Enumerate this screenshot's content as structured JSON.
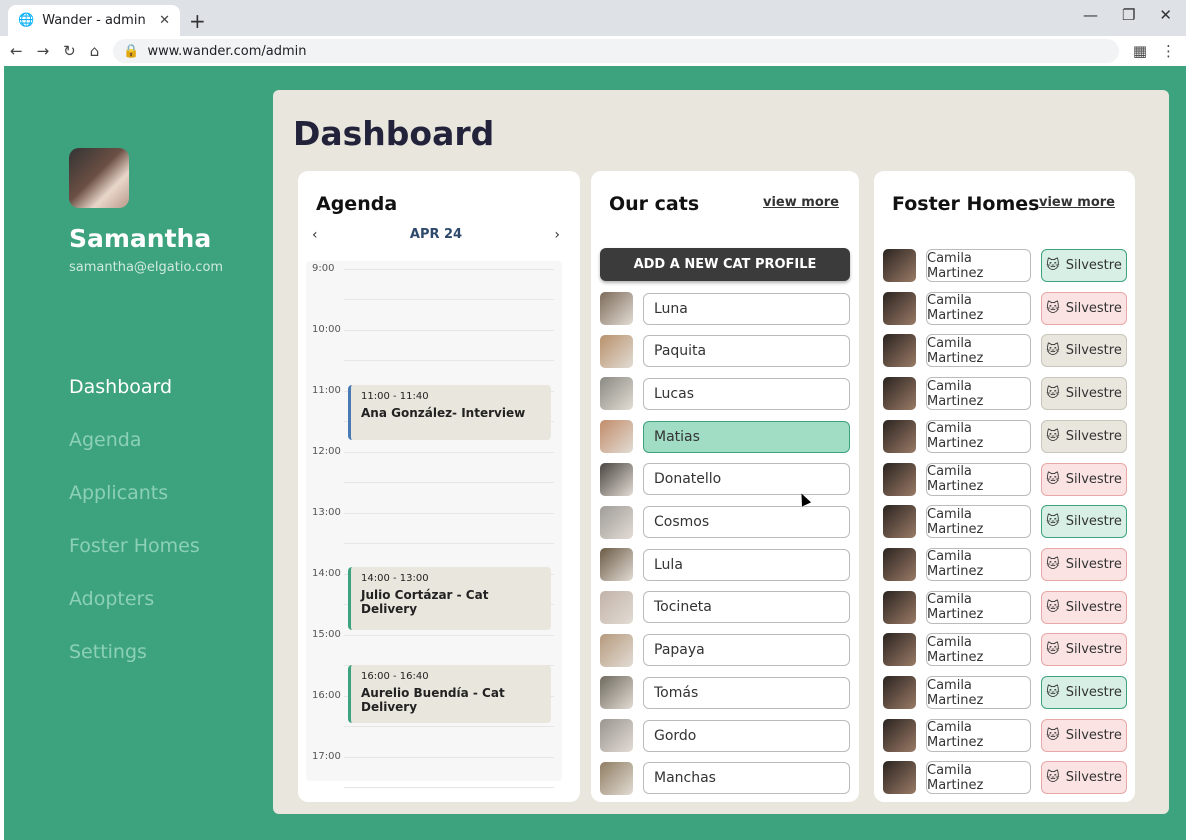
{
  "browser": {
    "tab_title": "Wander - admin",
    "url": "www.wander.com/admin"
  },
  "user": {
    "name": "Samantha",
    "email": "samantha@elgatio.com"
  },
  "nav": [
    "Dashboard",
    "Agenda",
    "Applicants",
    "Foster Homes",
    "Adopters",
    "Settings"
  ],
  "page_title": "Dashboard",
  "agenda": {
    "title": "Agenda",
    "date": "APR 24",
    "prev": "‹",
    "next": "›",
    "hours": [
      "9:00",
      "10:00",
      "11:00",
      "12:00",
      "13:00",
      "14:00",
      "15:00",
      "16:00",
      "17:00"
    ],
    "events": [
      {
        "time": "11:00 - 11:40",
        "name": "Ana González- Interview",
        "accent": "#4a7ab5"
      },
      {
        "time": "14:00 - 13:00",
        "name": "Julio Cortázar - Cat Delivery",
        "accent": "#3da37f"
      },
      {
        "time": "16:00 - 16:40",
        "name": "Aurelio Buendía - Cat Delivery",
        "accent": "#3da37f"
      }
    ]
  },
  "cats": {
    "title": "Our cats",
    "view_more": "view more",
    "add_button": "ADD A NEW CAT PROFILE",
    "selected": "Matias",
    "items": [
      "Luna",
      "Paquita",
      "Lucas",
      "Matias",
      "Donatello",
      "Cosmos",
      "Lula",
      "Tocineta",
      "Papaya",
      "Tomás",
      "Gordo",
      "Manchas"
    ]
  },
  "foster": {
    "title": "Foster Homes",
    "view_more": "view more",
    "rows": [
      {
        "name": "Camila Martinez",
        "cat": "Silvestre",
        "status": "green"
      },
      {
        "name": "Camila Martinez",
        "cat": "Silvestre",
        "status": "red"
      },
      {
        "name": "Camila Martinez",
        "cat": "Silvestre",
        "status": "grey"
      },
      {
        "name": "Camila Martinez",
        "cat": "Silvestre",
        "status": "grey"
      },
      {
        "name": "Camila Martinez",
        "cat": "Silvestre",
        "status": "grey"
      },
      {
        "name": "Camila Martinez",
        "cat": "Silvestre",
        "status": "red"
      },
      {
        "name": "Camila Martinez",
        "cat": "Silvestre",
        "status": "green"
      },
      {
        "name": "Camila Martinez",
        "cat": "Silvestre",
        "status": "red"
      },
      {
        "name": "Camila Martinez",
        "cat": "Silvestre",
        "status": "red"
      },
      {
        "name": "Camila Martinez",
        "cat": "Silvestre",
        "status": "red"
      },
      {
        "name": "Camila Martinez",
        "cat": "Silvestre",
        "status": "green"
      },
      {
        "name": "Camila Martinez",
        "cat": "Silvestre",
        "status": "red"
      },
      {
        "name": "Camila Martinez",
        "cat": "Silvestre",
        "status": "red"
      }
    ]
  },
  "colors": {
    "brand": "#3da37f",
    "panel": "#e8e6dd",
    "dark": "#22233b",
    "selected": "#a1dcc4"
  }
}
